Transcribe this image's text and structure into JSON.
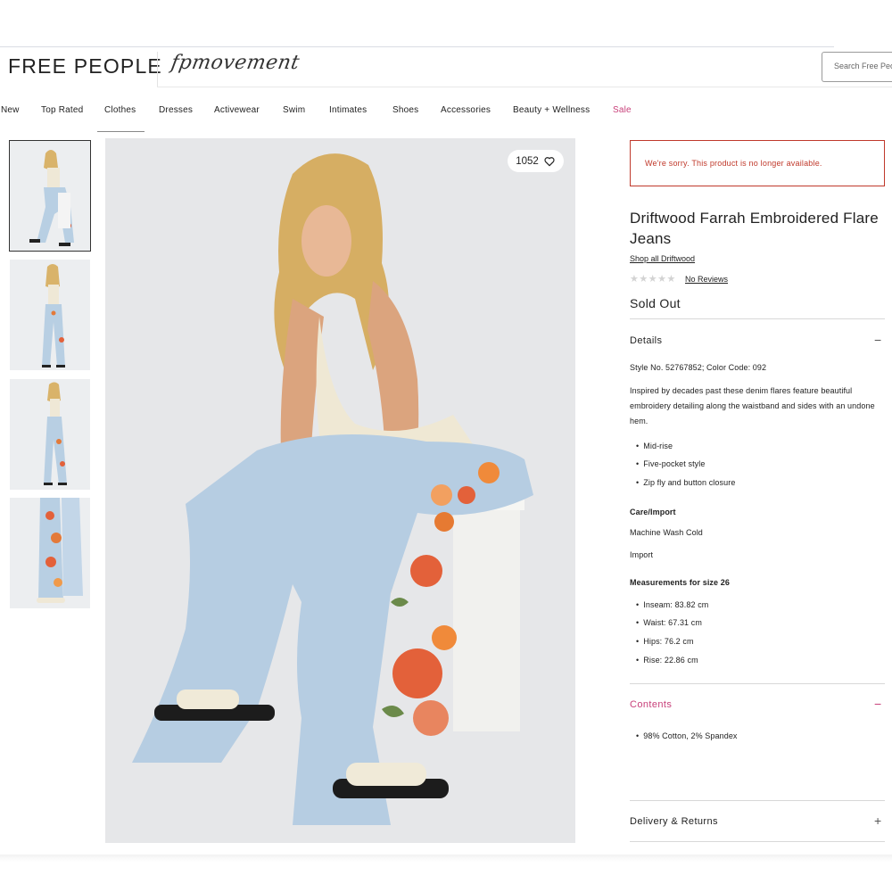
{
  "header": {
    "logo": "FREE PEOPLE",
    "brand_script": "fpmovement",
    "search_placeholder": "Search Free People"
  },
  "nav": {
    "items": [
      "New",
      "Top Rated",
      "Clothes",
      "Dresses",
      "Activewear",
      "Swim",
      "Intimates",
      "Shoes",
      "Accessories",
      "Beauty + Wellness",
      "Sale"
    ],
    "active": "Clothes"
  },
  "gallery": {
    "thumbnails": [
      "thumb-front-seated",
      "thumb-back-standing",
      "thumb-side-standing",
      "thumb-leg-closeup"
    ],
    "active_thumbnail": 0,
    "favorite_count": "1052"
  },
  "product": {
    "notice": "We're sorry. This product is no longer available.",
    "title": "Driftwood Farrah Embroidered Flare Jeans",
    "shop_all": "Shop all Driftwood",
    "rating_stars": 0,
    "reviews_link": "No Reviews",
    "status": "Sold Out"
  },
  "details": {
    "heading": "Details",
    "style_line": "Style No. 52767852; Color Code: 092",
    "description": "Inspired by decades past these denim flares feature beautiful embroidery detailing along the waistband and sides with an undone hem.",
    "features": [
      "Mid-rise",
      "Five-pocket style",
      "Zip fly and button closure"
    ],
    "care_heading": "Care/Import",
    "care": [
      "Machine Wash Cold",
      "Import"
    ],
    "measurements_heading": "Measurements for size 26",
    "measurements": [
      "Inseam: 83.82 cm",
      "Waist: 67.31 cm",
      "Hips: 76.2 cm",
      "Rise: 22.86 cm"
    ]
  },
  "contents": {
    "heading": "Contents",
    "items": [
      "98% Cotton, 2% Spandex"
    ]
  },
  "delivery": {
    "heading": "Delivery & Returns"
  },
  "colors": {
    "accent_pink": "#c8407a",
    "error_red": "#c0392b",
    "text": "#222222"
  }
}
